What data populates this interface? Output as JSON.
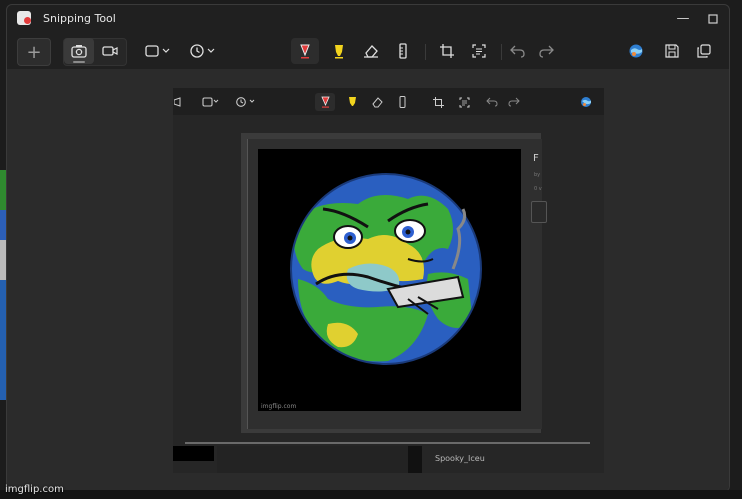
{
  "window": {
    "title": "Snipping Tool",
    "minimize_icon": "minimize-icon",
    "maximize_icon": "maximize-icon"
  },
  "toolbar": {
    "new_label": "+",
    "icons": [
      "camera-icon",
      "video-icon",
      "rectangle-mode-icon",
      "delay-timer-icon",
      "ballpoint-pen-icon",
      "highlighter-icon",
      "eraser-icon",
      "ruler-icon",
      "crop-icon",
      "text-actions-icon",
      "undo-icon",
      "redo-icon",
      "paint-3d-icon",
      "save-icon",
      "copy-icon"
    ]
  },
  "inner_screenshot": {
    "side_title": "F",
    "side_line1": "by",
    "side_line2": "0 v",
    "meme_watermark": "imgflip.com",
    "username": "Spooky_Iceu"
  },
  "watermark": "imgflip.com",
  "colors": {
    "accent_red": "#e23c3c",
    "highlighter_yellow": "#f2d41e",
    "window_bg": "#202020",
    "canvas_bg": "#2b2b2b"
  }
}
